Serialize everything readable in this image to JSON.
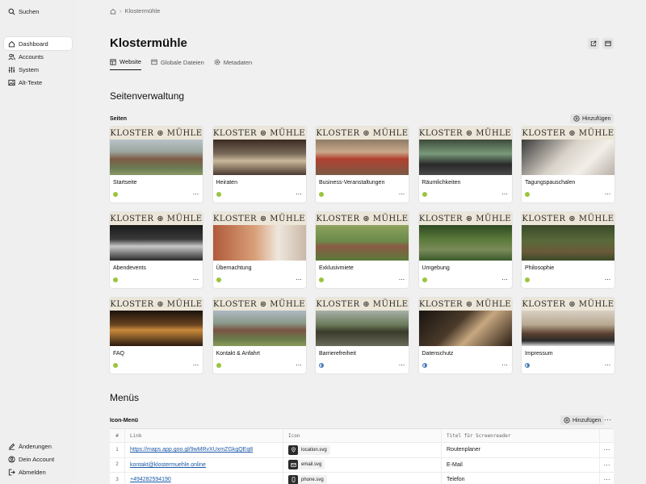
{
  "sidebar": {
    "search": "Suchen",
    "items": [
      {
        "label": "Dashboard",
        "icon": "home-icon",
        "active": true
      },
      {
        "label": "Accounts",
        "icon": "users-icon"
      },
      {
        "label": "System",
        "icon": "sliders-icon"
      },
      {
        "label": "Alt-Texte",
        "icon": "image-icon"
      }
    ],
    "bottom": [
      {
        "label": "Änderungen",
        "icon": "pencil-icon"
      },
      {
        "label": "Dein Account",
        "icon": "user-circle-icon"
      },
      {
        "label": "Abmelden",
        "icon": "logout-icon"
      }
    ]
  },
  "breadcrumb": {
    "page": "Klostermühle"
  },
  "header": {
    "title": "Klostermühle"
  },
  "tabs": [
    {
      "label": "Website",
      "active": true
    },
    {
      "label": "Globale Dateien"
    },
    {
      "label": "Metadaten"
    }
  ],
  "pages_section": {
    "title": "Seitenverwaltung",
    "label": "Seiten",
    "add_label": "Hinzufügen",
    "logo_text": "KLOSTER ⊛ MÜHLE",
    "cards": [
      {
        "name": "Startseite",
        "status": "green"
      },
      {
        "name": "Heiraten",
        "status": "green"
      },
      {
        "name": "Business-Veranstaltungen",
        "status": "green"
      },
      {
        "name": "Räumlichkeiten",
        "status": "green"
      },
      {
        "name": "Tagungspauschalen",
        "status": "green"
      },
      {
        "name": "Abendevents",
        "status": "green"
      },
      {
        "name": "Übernachtung",
        "status": "green"
      },
      {
        "name": "Exklusivmiete",
        "status": "green"
      },
      {
        "name": "Umgebung",
        "status": "green"
      },
      {
        "name": "Philosophie",
        "status": "green"
      },
      {
        "name": "FAQ",
        "status": "green"
      },
      {
        "name": "Kontakt & Anfahrt",
        "status": "green"
      },
      {
        "name": "Barrierefreiheit",
        "status": "half"
      },
      {
        "name": "Datenschutz",
        "status": "half"
      },
      {
        "name": "Impressum",
        "status": "half"
      }
    ]
  },
  "menus_section": {
    "title": "Menüs",
    "label": "Icon-Menü",
    "add_label": "Hinzufügen",
    "columns": [
      "#",
      "Link",
      "Icon",
      "Titel für Screenreader"
    ],
    "rows": [
      {
        "num": "1",
        "link": "https://maps.app.goo.gl/9wMRvXUxmZGkgQEq8",
        "icon": "location.svg",
        "title": "Routenplaner"
      },
      {
        "num": "2",
        "link": "kontakt@klostermuehle.online",
        "icon": "email.svg",
        "title": "E-Mail"
      },
      {
        "num": "3",
        "link": "+494282594190",
        "icon": "phone.svg",
        "title": "Telefon"
      }
    ]
  },
  "colors": {
    "status_green": "#9bc43d",
    "status_partial": "#4a7ab8",
    "link": "#1d5aa6"
  }
}
